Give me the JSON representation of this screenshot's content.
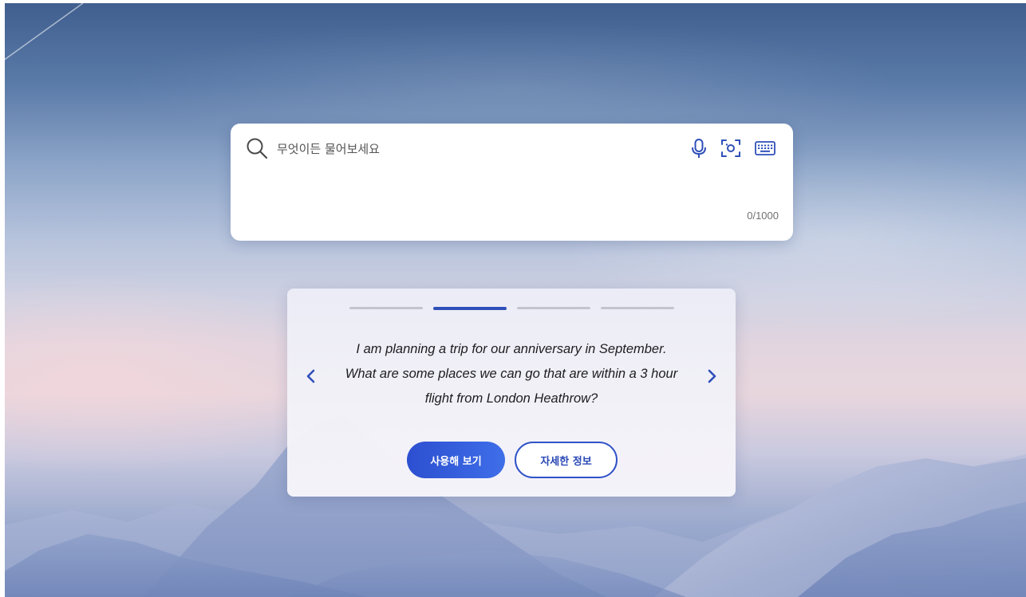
{
  "search": {
    "placeholder": "무엇이든 물어보세요",
    "char_count": "0/1000",
    "icons": [
      "search-icon",
      "microphone-icon",
      "visual-search-icon",
      "keyboard-icon"
    ]
  },
  "suggestion": {
    "prompt": "I am planning a trip for our anniversary in September. What are some places we can go that are within a 3 hour flight from London Heathrow?",
    "try_label": "사용해 보기",
    "learn_label": "자세한 정보",
    "pagination_total": 4,
    "active_index": 2
  },
  "colors": {
    "accent": "#2f4fb9",
    "button_primary": "#3259d8",
    "background_top": "#3f5e8e",
    "background_horizon": "#e8d6dd"
  }
}
